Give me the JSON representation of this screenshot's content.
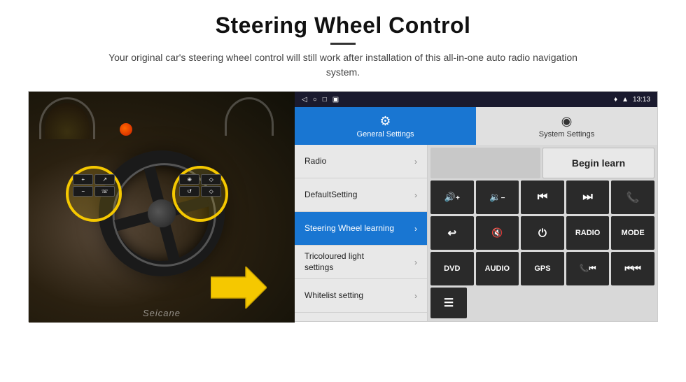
{
  "header": {
    "title": "Steering Wheel Control",
    "subtitle": "Your original car's steering wheel control will still work after installation of this all-in-one auto radio navigation system."
  },
  "status_bar": {
    "icons": [
      "◁",
      "○",
      "□",
      "▣"
    ],
    "right": "♦ ▲  13:13"
  },
  "tabs": [
    {
      "id": "general",
      "icon": "⚙",
      "label": "General Settings",
      "active": true
    },
    {
      "id": "system",
      "icon": "◎",
      "label": "System Settings",
      "active": false
    }
  ],
  "menu": {
    "items": [
      {
        "id": "radio",
        "label": "Radio",
        "active": false
      },
      {
        "id": "default-setting",
        "label": "DefaultSetting",
        "active": false
      },
      {
        "id": "steering-wheel",
        "label": "Steering Wheel learning",
        "active": true
      },
      {
        "id": "tricoloured",
        "label": "Tricoloured light\nsettings",
        "active": false
      },
      {
        "id": "whitelist",
        "label": "Whitelist setting",
        "active": false
      }
    ]
  },
  "grid": {
    "begin_learn_label": "Begin learn",
    "buttons_row1": [
      {
        "id": "vol-up",
        "icon": "🔊+",
        "label": "vol-up"
      },
      {
        "id": "vol-down",
        "icon": "🔉-",
        "label": "vol-down"
      },
      {
        "id": "prev-track",
        "icon": "⏮",
        "label": "prev-track"
      },
      {
        "id": "next-track",
        "icon": "⏭",
        "label": "next-track"
      },
      {
        "id": "phone",
        "icon": "📞",
        "label": "phone"
      }
    ],
    "buttons_row2": [
      {
        "id": "back",
        "icon": "↩",
        "label": "back"
      },
      {
        "id": "mute",
        "icon": "🔇",
        "label": "mute"
      },
      {
        "id": "power",
        "icon": "⏻",
        "label": "power"
      },
      {
        "id": "radio-btn",
        "label": "RADIO",
        "text": true
      },
      {
        "id": "mode-btn",
        "label": "MODE",
        "text": true
      }
    ],
    "buttons_row3": [
      {
        "id": "dvd",
        "label": "DVD",
        "text": true
      },
      {
        "id": "audio",
        "label": "AUDIO",
        "text": true
      },
      {
        "id": "gps",
        "label": "GPS",
        "text": true
      },
      {
        "id": "phone-prev",
        "icon": "📞⏮",
        "label": "phone-prev"
      },
      {
        "id": "prev-skip",
        "icon": "⏮⏮",
        "label": "prev-skip"
      }
    ],
    "buttons_row4": [
      {
        "id": "list",
        "icon": "☰",
        "label": "list"
      }
    ]
  },
  "watermark": "Seicane"
}
